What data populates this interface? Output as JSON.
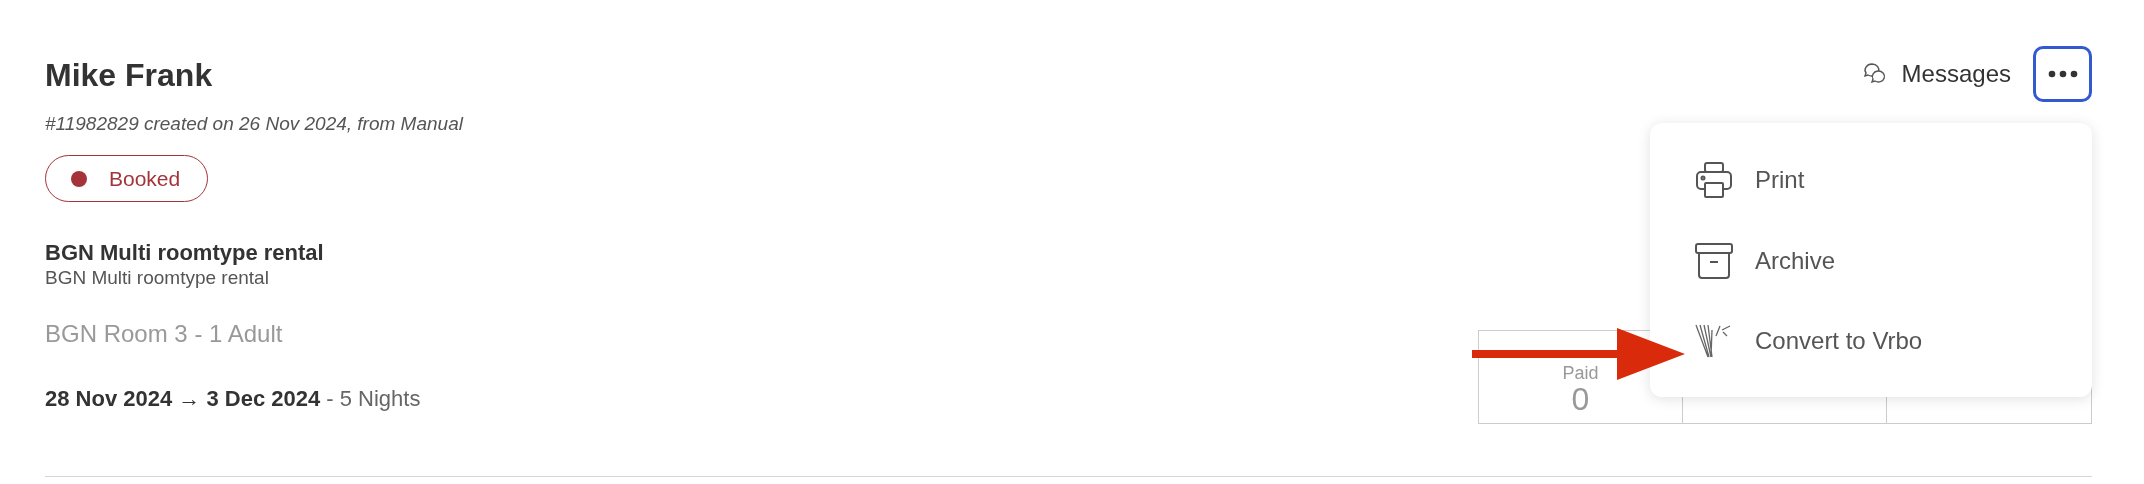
{
  "guest": {
    "name": "Mike Frank",
    "meta": "#11982829 created on 26 Nov 2024, from Manual",
    "status": {
      "label": "Booked",
      "color": "#a4343a"
    }
  },
  "rental": {
    "title": "BGN Multi roomtype rental",
    "subtitle": "BGN Multi roomtype rental",
    "room": "BGN Room 3 - 1 Adult",
    "date_range": "28 Nov 2024 → 3 Dec 2024",
    "nights": "- 5 Nights"
  },
  "actions": {
    "messages": "Messages",
    "more_expanded": true
  },
  "menu": [
    {
      "kind": "print",
      "label": "Print"
    },
    {
      "kind": "archive",
      "label": "Archive"
    },
    {
      "kind": "vrbo",
      "label": "Convert to Vrbo"
    }
  ],
  "payments": [
    {
      "label": "Paid",
      "value": "0"
    }
  ]
}
